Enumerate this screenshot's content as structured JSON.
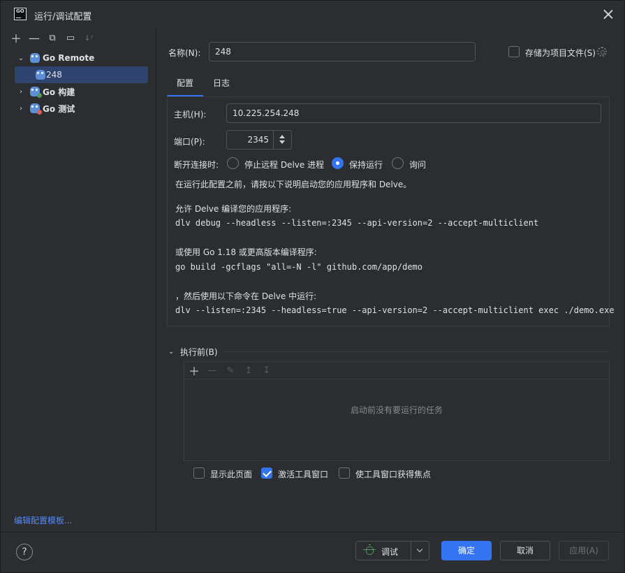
{
  "window": {
    "title": "运行/调试配置"
  },
  "left_toolbar": {
    "icons": [
      "add-icon",
      "remove-icon",
      "copy-icon",
      "new-folder-icon",
      "sort-icon"
    ]
  },
  "tree": {
    "items": [
      {
        "label": "Go Remote",
        "expanded": true
      },
      {
        "label": "248",
        "selected": true
      },
      {
        "label": "Go 构建",
        "expanded": false
      },
      {
        "label": "Go 测试",
        "expanded": false
      }
    ]
  },
  "edit_templates_link": "编辑配置模板...",
  "name_field": {
    "label": "名称(N):",
    "value": "248"
  },
  "store_as_project": {
    "label": "存储为项目文件(S)",
    "checked": false
  },
  "tabs": [
    {
      "label": "配置",
      "active": true
    },
    {
      "label": "日志",
      "active": false
    }
  ],
  "host": {
    "label": "主机(H):",
    "value": "10.225.254.248"
  },
  "port": {
    "label": "端口(P):",
    "value": "2345"
  },
  "on_disconnect": {
    "label": "断开连接时:",
    "options": [
      {
        "label": "停止远程 Delve 进程",
        "checked": false
      },
      {
        "label": "保持运行",
        "checked": true
      },
      {
        "label": "询问",
        "checked": false
      }
    ]
  },
  "instructions": {
    "intro": "在运行此配置之前，请按以下说明启动您的应用程序和 Delve。",
    "step1_title": "允许 Delve 编译您的应用程序:",
    "step1_cmd": "dlv debug --headless --listen=:2345 --api-version=2 --accept-multiclient",
    "step2_title": "或使用 Go 1.18 或更高版本编译程序:",
    "step2_cmd": "go build -gcflags \"all=-N -l\" github.com/app/demo",
    "step3_title": "，然后使用以下命令在 Delve 中运行:",
    "step3_cmd": "dlv --listen=:2345 --headless=true --api-version=2 --accept-multiclient exec ./demo.exe"
  },
  "before_launch": {
    "label": "执行前(B)",
    "empty_text": "启动前没有要运行的任务",
    "toolbar_icons": [
      "add-icon",
      "remove-icon",
      "edit-icon",
      "move-up-icon",
      "move-down-icon"
    ]
  },
  "options": [
    {
      "label": "显示此页面",
      "checked": false
    },
    {
      "label": "激活工具窗口",
      "checked": true
    },
    {
      "label": "使工具窗口获得焦点",
      "checked": false
    }
  ],
  "buttons": {
    "help": "?",
    "debug": "调试",
    "ok": "确定",
    "cancel": "取消",
    "apply": "应用(A)"
  }
}
